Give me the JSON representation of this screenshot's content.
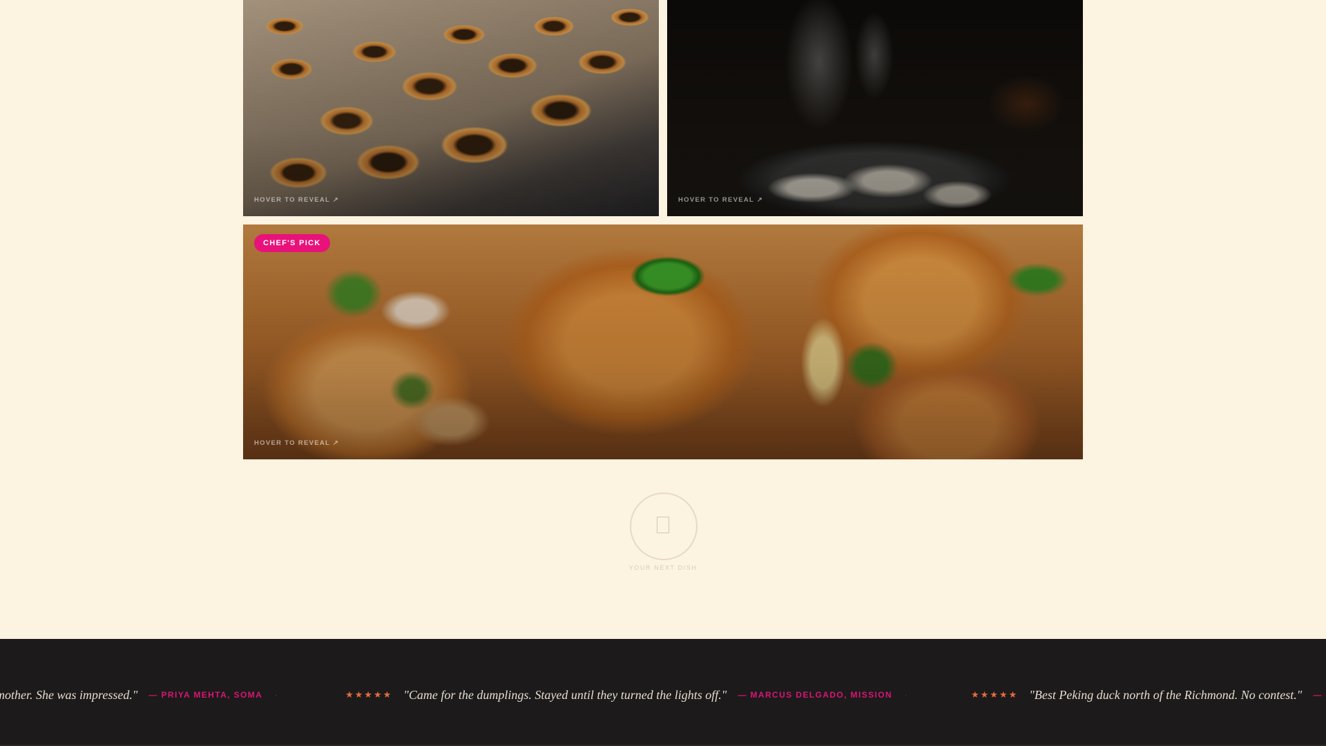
{
  "gallery": {
    "tiles": [
      {
        "subject": "egg tarts",
        "caption": "HOVER TO REVEAL ↗"
      },
      {
        "subject": "steamed dumplings",
        "caption": "HOVER TO REVEAL ↗"
      },
      {
        "subject": "salt and pepper shrimp",
        "caption": "HOVER TO REVEAL ↗",
        "badge": "CHEF'S PICK"
      }
    ],
    "badge_color": "#e8127a"
  },
  "next_dish": {
    "label": "YOUR NEXT DISH",
    "icon": "placeholder-icon"
  },
  "testimonials": {
    "background": "#1c1a1a",
    "star_color": "#e56c3f",
    "author_color": "#d81675",
    "items": [
      {
        "stars": "",
        "quote": "mother. She was impressed.\"",
        "author": "— PRIYA MEHTA, SOMA"
      },
      {
        "stars": "★★★★★",
        "quote": "\"Came for the dumplings. Stayed until they turned the lights off.\"",
        "author": "— MARCUS DELGADO, MISSION"
      },
      {
        "stars": "★★★★★",
        "quote": "\"Best Peking duck north of the Richmond. No contest.\"",
        "author": "— J"
      }
    ],
    "separator": "·"
  }
}
